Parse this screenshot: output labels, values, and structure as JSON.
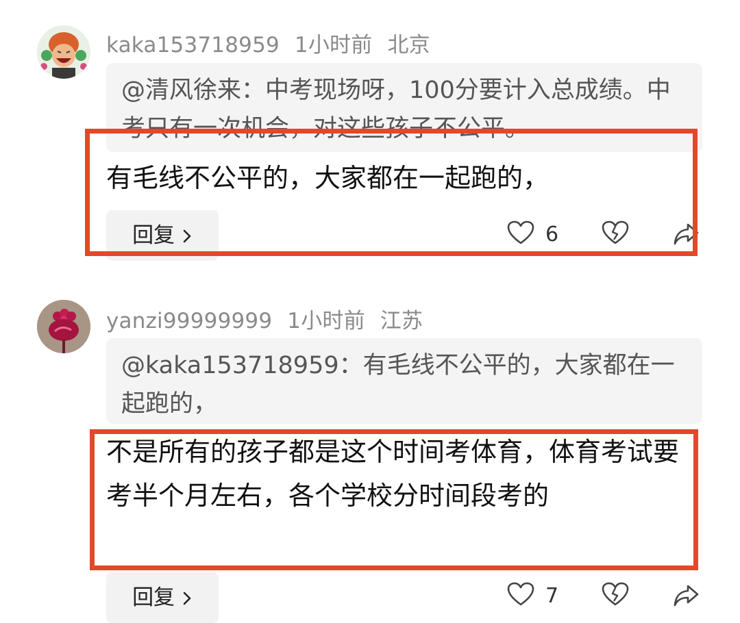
{
  "comments": [
    {
      "username": "kaka153718959",
      "time": "1小时前",
      "location": "北京",
      "quote": "@清风徐来：中考现场呀，100分要计入总成绩。中考只有一次机会，对这些孩子不公平。",
      "text": "有毛线不公平的，大家都在一起跑的，",
      "reply_label": "回复",
      "likes": "6"
    },
    {
      "username": "yanzi99999999",
      "time": "1小时前",
      "location": "江苏",
      "quote": "@kaka153718959：有毛线不公平的，大家都在一起跑的，",
      "text": "不是所有的孩子都是这个时间考体育，体育考试要考半个月左右，各个学校分时间段考的",
      "reply_label": "回复",
      "likes": "7"
    }
  ],
  "icons": {
    "like": "heart-outline-icon",
    "dislike": "broken-heart-icon",
    "share": "share-arrow-icon",
    "reply_chevron": "chevron-right-icon"
  },
  "colors": {
    "highlight": "#e2482b",
    "quote_bg": "#f4f4f5",
    "meta_text": "#8a8a8a"
  }
}
